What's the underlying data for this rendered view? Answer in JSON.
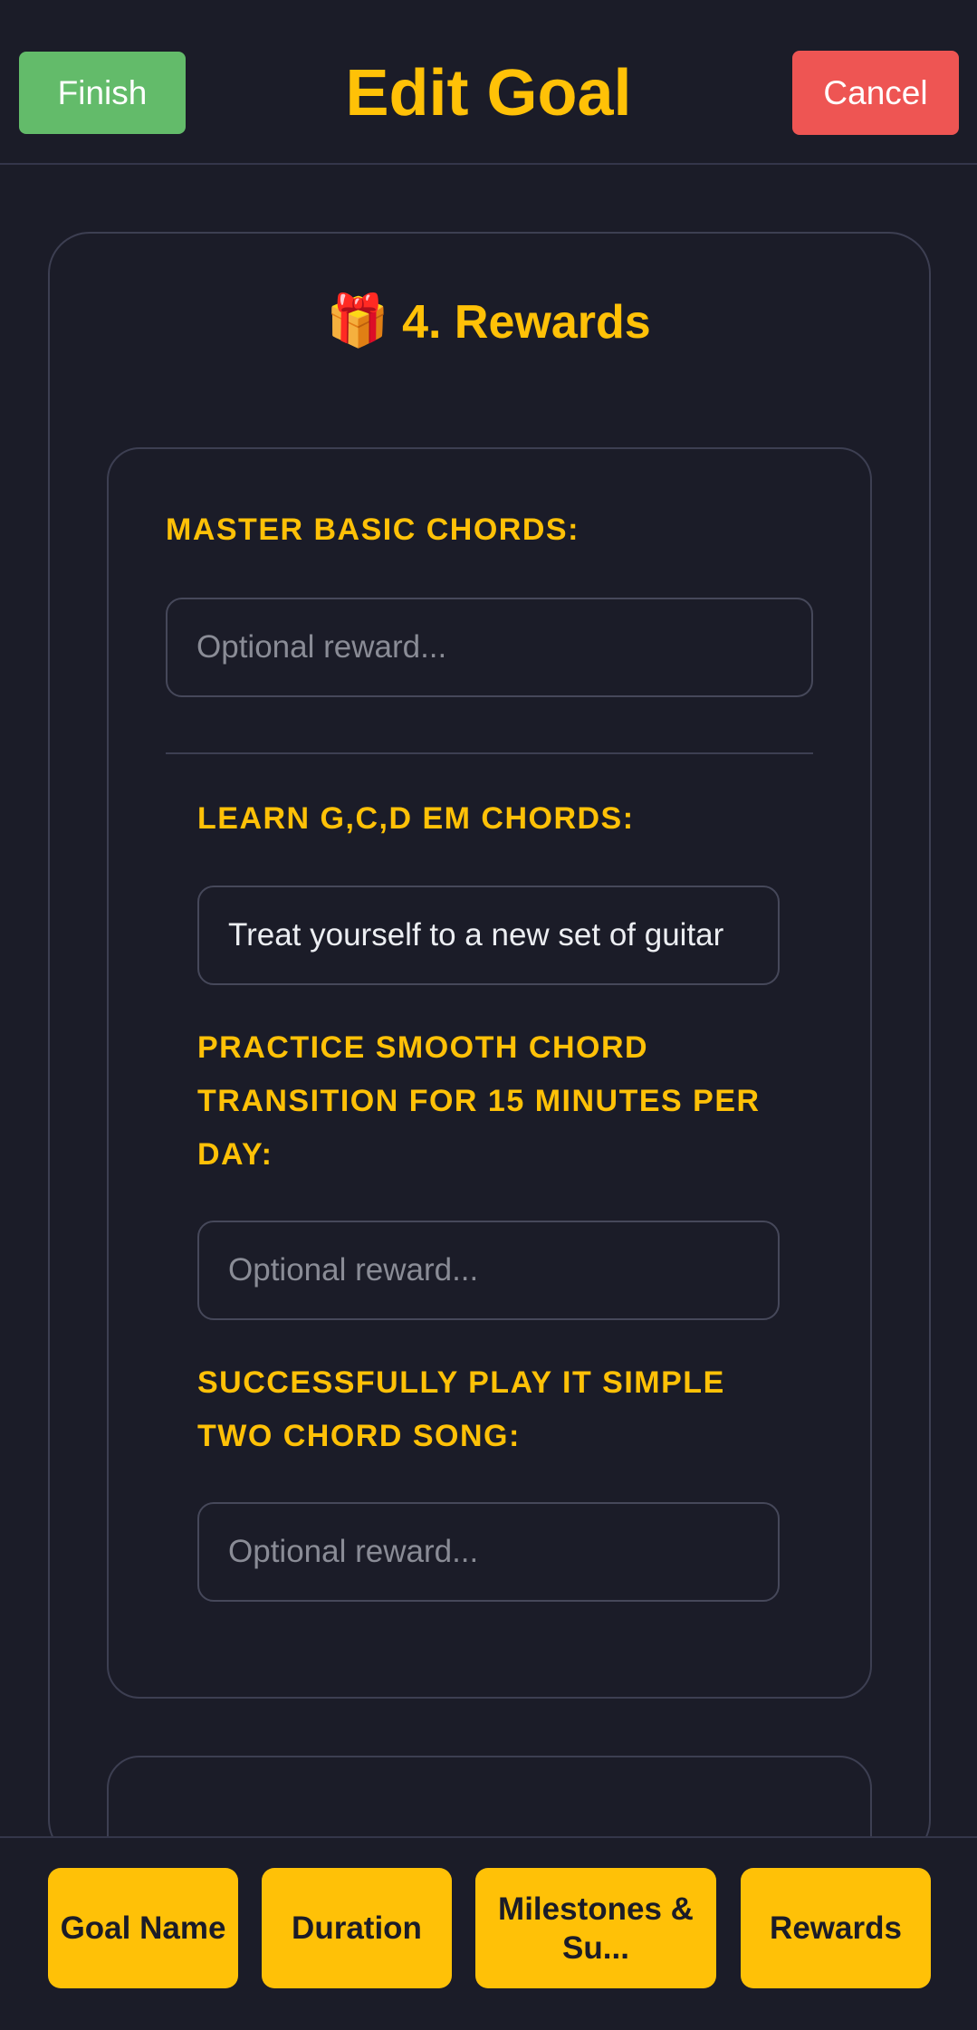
{
  "header": {
    "title": "Edit Goal",
    "finish_label": "Finish",
    "cancel_label": "Cancel"
  },
  "section": {
    "icon": "gift-icon",
    "title": "4. Rewards"
  },
  "milestone": {
    "label": "MASTER BASIC CHORDS:",
    "reward_placeholder": "Optional reward...",
    "reward_value": ""
  },
  "sub_steps": [
    {
      "label": "LEARN G,C,D EM CHORDS:",
      "reward_placeholder": "Optional reward...",
      "reward_value": "Treat yourself to a new set of guitar"
    },
    {
      "label": "PRACTICE SMOOTH CHORD TRANSITION FOR 15 MINUTES PER DAY:",
      "reward_placeholder": "Optional reward...",
      "reward_value": ""
    },
    {
      "label": "SUCCESSFULLY PLAY IT SIMPLE TWO CHORD SONG:",
      "reward_placeholder": "Optional reward...",
      "reward_value": ""
    }
  ],
  "bottom_tabs": [
    {
      "label": "Goal Name"
    },
    {
      "label": "Duration"
    },
    {
      "label": "Milestones & Su..."
    },
    {
      "label": "Rewards"
    }
  ],
  "colors": {
    "background": "#1b1c28",
    "accent": "#ffc107",
    "finish": "#63bb6a",
    "cancel": "#ee5553",
    "border": "#3d3f52"
  }
}
